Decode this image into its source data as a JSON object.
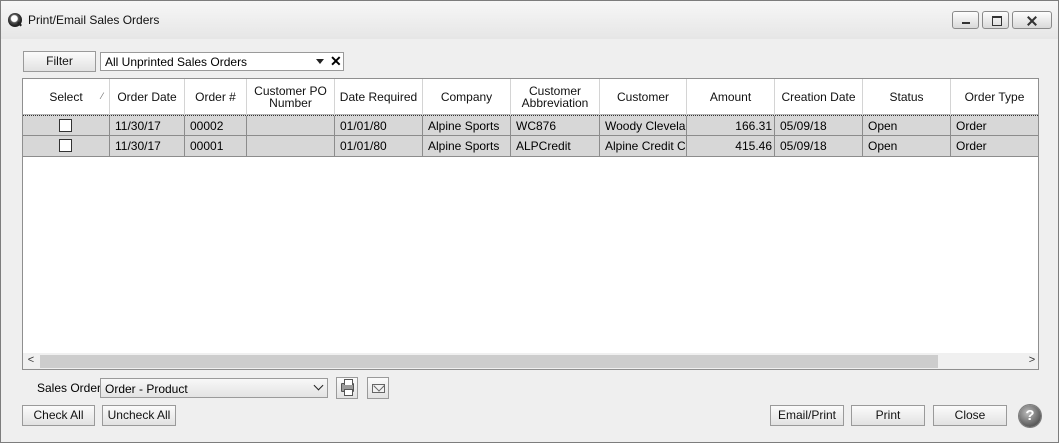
{
  "window": {
    "title": "Print/Email Sales Orders",
    "icon": "app-logo-icon"
  },
  "toolbar": {
    "filter_label": "Filter",
    "filter_value": "All Unprinted Sales Orders"
  },
  "grid": {
    "columns": [
      "Select",
      "Order Date",
      "Order #",
      "Customer PO Number",
      "Date Required",
      "Company",
      "Customer Abbreviation",
      "Customer",
      "Amount",
      "Creation Date",
      "Status",
      "Order Type"
    ],
    "rows": [
      {
        "selected": false,
        "order_date": "11/30/17",
        "order_no": "00002",
        "customer_po": "",
        "date_required": "01/01/80",
        "company": "Alpine Sports",
        "abbreviation": "WC876",
        "customer": "Woody Clevela",
        "amount": "166.31",
        "creation_date": "05/09/18",
        "status": "Open",
        "order_type": "Order"
      },
      {
        "selected": false,
        "order_date": "11/30/17",
        "order_no": "00001",
        "customer_po": "",
        "date_required": "01/01/80",
        "company": "Alpine Sports",
        "abbreviation": "ALPCredit",
        "customer": "Alpine Credit C",
        "amount": "415.46",
        "creation_date": "05/09/18",
        "status": "Open",
        "order_type": "Order"
      }
    ]
  },
  "footer": {
    "sales_order_label": "Sales Order",
    "sales_order_value": "Order - Product",
    "check_all": "Check All",
    "uncheck_all": "Uncheck All",
    "email_print": "Email/Print",
    "print": "Print",
    "close": "Close",
    "help_glyph": "?"
  },
  "icons": [
    "app-logo-icon",
    "printer-icon",
    "envelope-icon",
    "help-icon",
    "chevron-down-icon",
    "clear-icon"
  ],
  "colors": {
    "row_background": "#d7d7d7",
    "window_background": "#efefef"
  }
}
